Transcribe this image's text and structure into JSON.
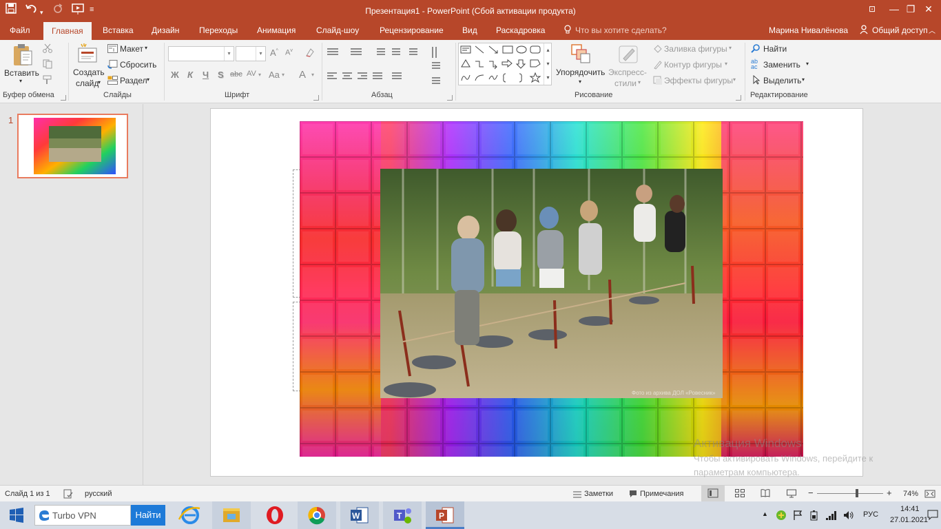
{
  "window": {
    "title": "Презентация1 - PowerPoint (Сбой активации продукта)"
  },
  "tabs": [
    {
      "label": "Файл"
    },
    {
      "label": "Главная"
    },
    {
      "label": "Вставка"
    },
    {
      "label": "Дизайн"
    },
    {
      "label": "Переходы"
    },
    {
      "label": "Анимация"
    },
    {
      "label": "Слайд-шоу"
    },
    {
      "label": "Рецензирование"
    },
    {
      "label": "Вид"
    },
    {
      "label": "Раскадровка"
    }
  ],
  "tell_me": "Что вы хотите сделать?",
  "user": "Марина Нивалёнова",
  "share": "Общий доступ",
  "ribbon": {
    "clipboard": {
      "label": "Буфер обмена",
      "paste": "Вставить"
    },
    "slides": {
      "label": "Слайды",
      "new_slide_1": "Создать",
      "new_slide_2": "слайд",
      "layout": "Макет",
      "reset": "Сбросить",
      "section": "Раздел"
    },
    "font": {
      "label": "Шрифт",
      "bold": "Ж",
      "italic": "К",
      "underline": "Ч",
      "shadow": "S",
      "strike": "abc",
      "spacing": "AV",
      "case": "Aa",
      "color": "A"
    },
    "paragraph": {
      "label": "Абзац"
    },
    "drawing": {
      "label": "Рисование",
      "arrange": "Упорядочить",
      "quick_styles_1": "Экспресс-",
      "quick_styles_2": "стили",
      "fill": "Заливка фигуры",
      "outline": "Контур фигуры",
      "effects": "Эффекты фигуры"
    },
    "editing": {
      "label": "Редактирование",
      "find": "Найти",
      "replace": "Заменить",
      "select": "Выделить"
    }
  },
  "thumbnail": {
    "number": "1"
  },
  "status": {
    "slide_of": "Слайд 1 из 1",
    "language": "русский",
    "notes": "Заметки",
    "comments": "Примечания",
    "zoom": "74%",
    "zoom_fraction": 0.6
  },
  "photo": {
    "watermark": "Фото из архива ДОЛ «Ровесник»"
  },
  "activation": {
    "title": "Активация Windows",
    "line1": "Чтобы активировать Windows, перейдите к",
    "line2": "параметрам компьютера."
  },
  "taskbar": {
    "search_value": "Turbo VPN",
    "search_button": "Найти",
    "lang": "РУС",
    "time": "14:41",
    "date": "27.01.2021"
  },
  "colors": {
    "accent": "#b7472a",
    "selection": "#e97b5e"
  }
}
